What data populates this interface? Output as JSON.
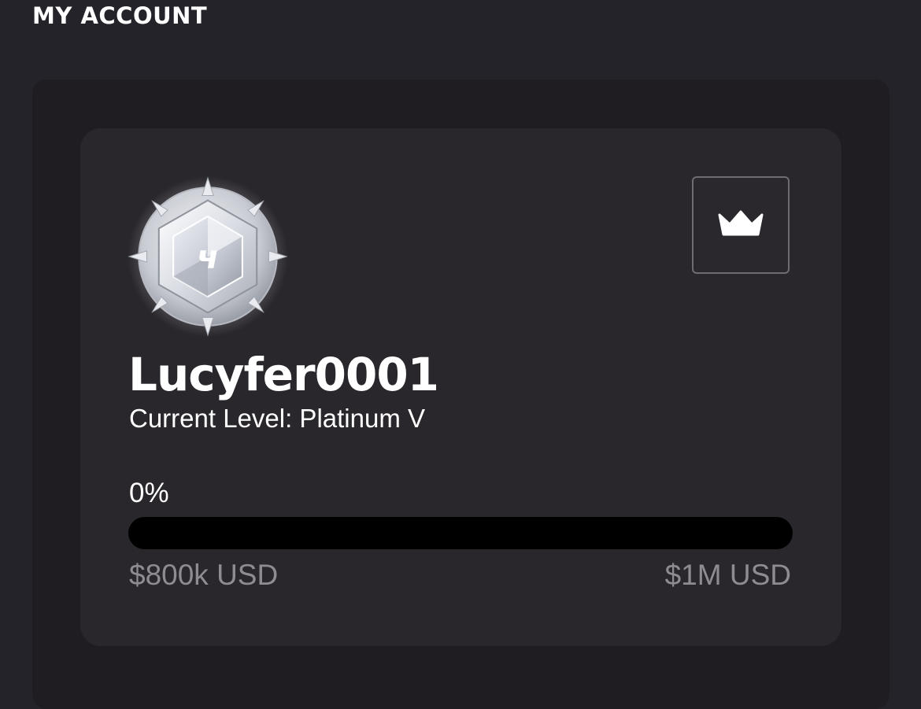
{
  "header": {
    "title": "MY ACCOUNT"
  },
  "account_card": {
    "badge_icon": "platinum-rank-badge-icon",
    "badge_glyph": "ч",
    "vip_button_icon": "crown-icon",
    "username": "Lucyfer0001",
    "current_level": "Current Level: Platinum V",
    "progress": {
      "percent_label": "0%",
      "fraction": 0,
      "range_min_label": "$800k USD",
      "range_max_label": "$1M USD"
    }
  },
  "colors": {
    "background": "#25232a",
    "outer_panel": "#1f1d22",
    "card": "#29272c",
    "progress_track": "#000000",
    "muted_text": "#8e8c92",
    "text": "#ffffff"
  }
}
